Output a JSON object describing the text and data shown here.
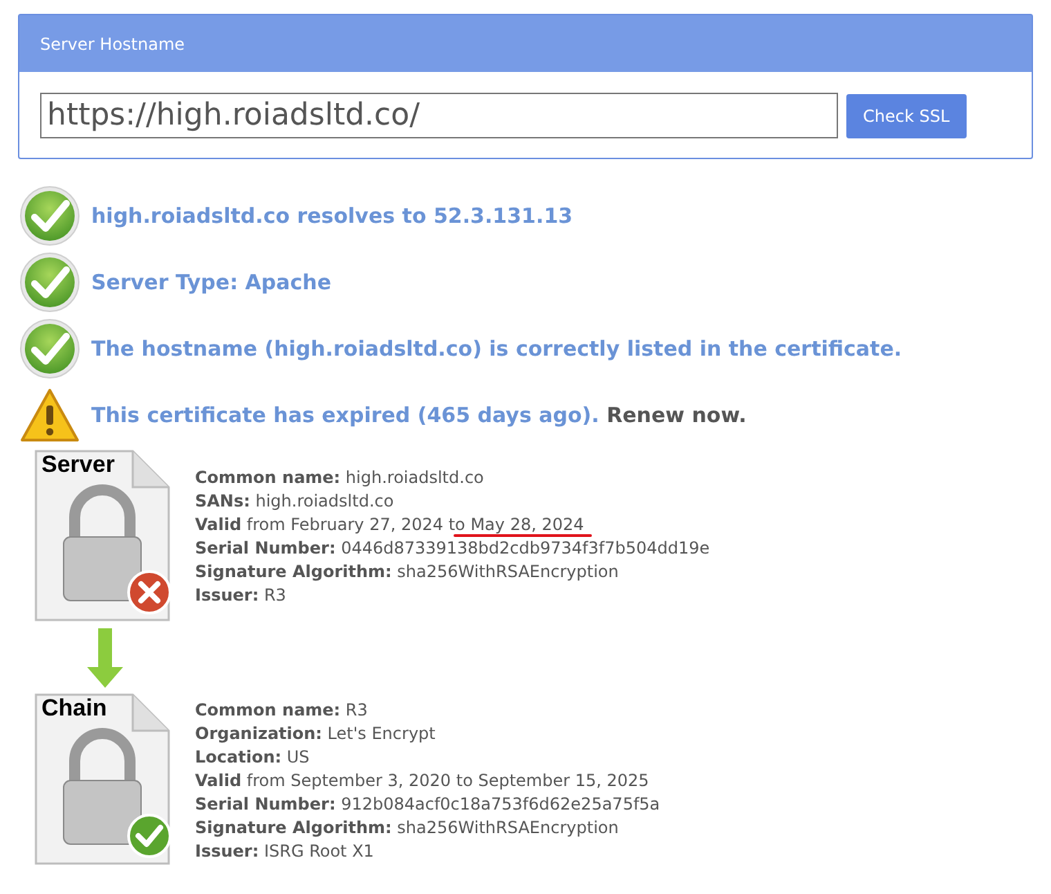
{
  "panel": {
    "title": "Server Hostname",
    "hostname": "https://high.roiadsltd.co/",
    "button": "Check SSL"
  },
  "checks": [
    {
      "kind": "ok",
      "text": "high.roiadsltd.co resolves to 52.3.131.13"
    },
    {
      "kind": "ok",
      "text": "Server Type: Apache"
    },
    {
      "kind": "ok",
      "text": "The hostname (high.roiadsltd.co) is correctly listed in the certificate."
    },
    {
      "kind": "warning",
      "text": "This certificate has expired (465 days ago).",
      "link": "Renew now."
    }
  ],
  "certificates": [
    {
      "label": "Server",
      "valid": false,
      "fields": [
        {
          "text": "**Common name:** high.roiadsltd.co"
        },
        {
          "text": "**SANs:** high.roiadsltd.co"
        },
        {
          "text": "**Valid** from February 27, 2024 to May 28, 2024",
          "annotated": true
        },
        {
          "text": "**Serial Number:** 0446d87339138bd2cdb9734f3f7b504dd19e"
        },
        {
          "text": "**Signature Algorithm:** sha256WithRSAEncryption"
        },
        {
          "text": "**Issuer:** R3"
        }
      ]
    },
    {
      "label": "Chain",
      "valid": true,
      "fields": [
        {
          "text": "**Common name:** R3"
        },
        {
          "text": "**Organization:** Let's Encrypt"
        },
        {
          "text": "**Location:** US"
        },
        {
          "text": "**Valid** from September 3, 2020 to September 15, 2025"
        },
        {
          "text": "**Serial Number:** 912b084acf0c18a753f6d62e25a75f5a"
        },
        {
          "text": "**Signature Algorithm:** sha256WithRSAEncryption"
        },
        {
          "text": "**Issuer:** ISRG Root X1"
        }
      ]
    }
  ]
}
